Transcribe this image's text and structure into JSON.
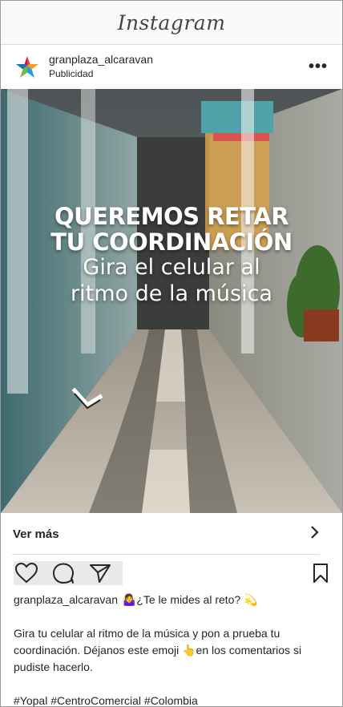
{
  "app": {
    "title": "Instagram"
  },
  "post": {
    "username": "granplaza_alcaravan",
    "sponsored_label": "Publicidad",
    "media": {
      "line1": "QUEREMOS RETAR",
      "line2": "TU COORDINACIÓN",
      "line3": "Gira el celular al",
      "line4": "ritmo de la música"
    },
    "cta_label": "Ver más",
    "caption": {
      "username": "granplaza_alcaravan",
      "first_line": "🤷‍♀️¿Te le mides al reto? 💫",
      "body": "Gira tu celular al ritmo de la música y pon a prueba tu coordinación. Déjanos este emoji 👆en los comentarios si pudiste hacerlo.",
      "hashtags": "#Yopal #CentroComercial #Colombia"
    }
  },
  "icons": {
    "avatar": "star-logo-icon",
    "more": "more-options-icon",
    "chevron": "chevron-right-icon",
    "like": "heart-icon",
    "comment": "comment-icon",
    "share": "send-icon",
    "save": "bookmark-icon"
  },
  "colors": {
    "text": "#262626",
    "divider": "#dbdbdb",
    "action_bg": "#e9e9e9"
  }
}
